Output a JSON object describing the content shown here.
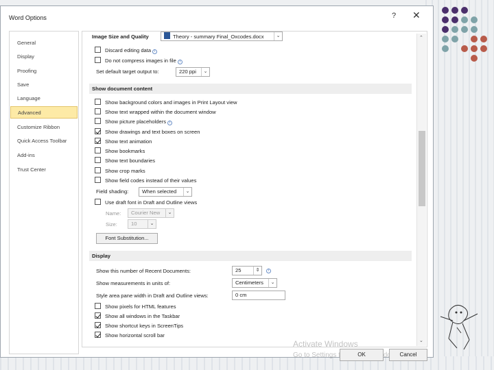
{
  "window": {
    "title": "Word Options",
    "help": "?",
    "close": "✕"
  },
  "nav": [
    "General",
    "Display",
    "Proofing",
    "Save",
    "Language",
    "Advanced",
    "Customize Ribbon",
    "Quick Access Toolbar",
    "Add-ins",
    "Trust Center"
  ],
  "image_section": {
    "title": "Image Size and Quality",
    "doc": "Theory - summary Final_Oxcodes.docx",
    "discard": "Discard editing data",
    "no_compress": "Do not compress images in file",
    "default_res_label": "Set default target output to:",
    "default_res": "220 ppi"
  },
  "show_doc": {
    "title": "Show document content",
    "items": [
      {
        "label": "Show background colors and images in Print Layout view",
        "checked": false
      },
      {
        "label": "Show text wrapped within the document window",
        "checked": false
      },
      {
        "label": "Show picture placeholders",
        "checked": false
      },
      {
        "label": "Show drawings and text boxes on screen",
        "checked": true
      },
      {
        "label": "Show text animation",
        "checked": true
      },
      {
        "label": "Show bookmarks",
        "checked": false
      },
      {
        "label": "Show text boundaries",
        "checked": false
      },
      {
        "label": "Show crop marks",
        "checked": false
      },
      {
        "label": "Show field codes instead of their values",
        "checked": false
      }
    ],
    "field_shading_label": "Field shading:",
    "field_shading": "When selected",
    "draft_font": "Use draft font in Draft and Outline views",
    "name_label": "Name:",
    "name_value": "Courier New",
    "size_label": "Size:",
    "size_value": "10",
    "font_subst": "Font Substitution..."
  },
  "display": {
    "title": "Display",
    "recent_label": "Show this number of Recent Documents:",
    "recent": "25",
    "units_label": "Show measurements in units of:",
    "units": "Centimeters",
    "style_label": "Style area pane width in Draft and Outline views:",
    "style": "0 cm",
    "items": [
      {
        "label": "Show pixels for HTML features",
        "checked": false
      },
      {
        "label": "Show all windows in the Taskbar",
        "checked": true
      },
      {
        "label": "Show shortcut keys in ScreenTips",
        "checked": true
      },
      {
        "label": "Show horizontal scroll bar",
        "checked": true
      }
    ]
  },
  "footer": {
    "ok": "OK",
    "cancel": "Cancel"
  },
  "watermark": {
    "line1": "Activate Windows",
    "line2": "Go to Settings to activate Windows."
  }
}
